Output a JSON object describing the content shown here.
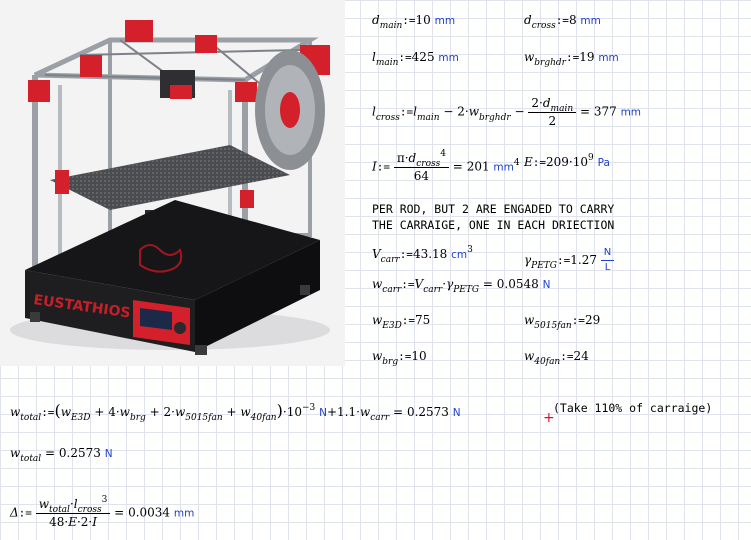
{
  "image": {
    "alt": "3D printer render",
    "brand": "EUSTATHIOS"
  },
  "vars": {
    "d": "d",
    "l": "l",
    "w": "w",
    "I": "I",
    "E": "E",
    "V": "V",
    "gamma": "γ",
    "delta": "Δ",
    "pi": "π"
  },
  "subs": {
    "main": "main",
    "cross": "cross",
    "brghdr": "brghdr",
    "carr": "carr",
    "PETG": "PETG",
    "E3D": "E3D",
    "5015fan": "5015fan",
    "brg": "brg",
    "40fan": "40fan",
    "total": "total"
  },
  "ops": {
    "def": ":=",
    "eq": "=",
    "minus": "−",
    "plus": "+",
    "dot": "·"
  },
  "units": {
    "mm": "mm",
    "Pa": "Pa",
    "cm": "cm",
    "N": "N",
    "L": "L"
  },
  "values": {
    "d_main": "10",
    "d_cross": "8",
    "l_main": "425",
    "w_brghdr": "19",
    "two": "2",
    "four": "4",
    "l_cross_result": "377",
    "I_exp": "4",
    "I_den": "64",
    "I_result": "201",
    "E_coef": "209",
    "E_base": "10",
    "E_exp": "9",
    "V_carr": "43.18",
    "V_exp": "3",
    "gamma_PETG": "1.27",
    "w_carr_result": "0.0548",
    "w_E3D": "75",
    "w_5015fan": "29",
    "w_brg": "10",
    "w_40fan": "24",
    "total_coef": "10",
    "total_exp": "−3",
    "carr_factor": "1.1",
    "w_total_result": "0.2573",
    "delta_exp": "3",
    "delta_den_48": "48",
    "delta_result": "0.0034"
  },
  "notes": {
    "per_rod": "PER ROD, BUT 2 ARE ENGADED TO CARRY",
    "carriage": " THE CARRAIGE, ONE IN EACH DRIECTION",
    "take_110": "(Take 110% of carraige)"
  },
  "colors": {
    "unit": "#1f3fd0",
    "grid": "#dfe4ec",
    "marker": "#e0102a",
    "printer_red": "#d4202a"
  }
}
